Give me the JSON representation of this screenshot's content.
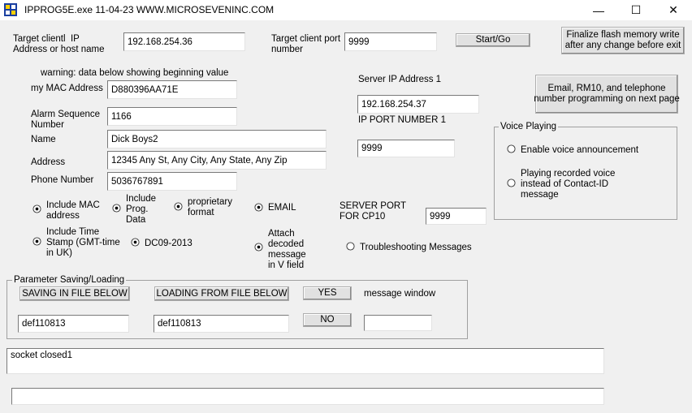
{
  "window": {
    "title": "IPPROG5E.exe 11-04-23   WWW.MICROSEVENINC.COM",
    "minimize": "—",
    "maximize": "☐",
    "close": "✕"
  },
  "connection": {
    "target_label": "Target clientl  IP\nAddress or host name",
    "target_value": "192.168.254.36",
    "port_label": "Target client port\nnumber",
    "port_value": "9999",
    "start_button": "Start/Go",
    "finalize_button": "Finalize flash memory write\nafter any change before exit"
  },
  "device": {
    "warning": "warning: data below showing beginning value",
    "mac_label": "my MAC Address",
    "mac_value": "D880396AA71E",
    "alarm_label": "Alarm Sequence\nNumber",
    "alarm_value": "1166",
    "name_label": "Name",
    "name_value": "Dick Boys2",
    "address_label": "Address",
    "address_value": "12345 Any St, Any City, Any State, Any Zip",
    "phone_label": "Phone Number",
    "phone_value": "5036767891"
  },
  "server": {
    "ip_label": "Server IP Address 1",
    "ip_value": "192.168.254.37",
    "port1_label": "IP PORT NUMBER 1",
    "port1_value": "9999",
    "port_cp10_label": "SERVER PORT\nFOR CP10",
    "port_cp10_value": "9999",
    "email_button": "Email, RM10, and telephone\nnumber programming on next page"
  },
  "voice": {
    "legend": "Voice Playing",
    "opt1": "Enable voice announcement",
    "opt2": "Playing recorded voice\ninstead of Contact-ID\nmessage"
  },
  "options": {
    "include_mac": "Include MAC\naddress",
    "include_prog": "Include\nProg.\nData",
    "proprietary": "proprietary\nformat",
    "email": "EMAIL",
    "include_time": "Include Time\nStamp (GMT-time\nin UK)",
    "dc09": "DC09-2013",
    "attach": "Attach\ndecoded\nmessage\nin V field",
    "troubleshooting": "Troubleshooting Messages"
  },
  "params": {
    "legend": "Parameter Saving/Loading",
    "save_button": "SAVING IN FILE BELOW",
    "load_button": "LOADING FROM FILE BELOW",
    "yes_button": "YES",
    "no_button": "NO",
    "message_window_label": "message window",
    "save_file": "def110813",
    "load_file": "def110813",
    "message_value": ""
  },
  "status": {
    "log": "socket closed1",
    "bottom": ""
  }
}
